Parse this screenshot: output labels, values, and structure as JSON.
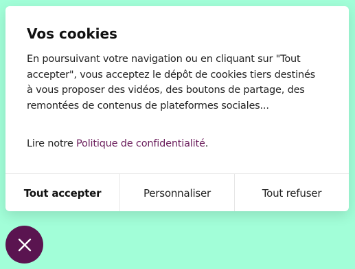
{
  "dialog": {
    "title": "Vos cookies",
    "body": "En poursuivant votre navigation ou en cliquant sur \"Tout accepter\", vous acceptez le dépôt de cookies tiers destinés à vous proposer des vidéos, des boutons de partage, des remontées de contenus de plateformes sociales...",
    "privacy_prefix": "Lire notre ",
    "privacy_link": "Politique de confidentialité",
    "privacy_suffix": "."
  },
  "buttons": {
    "accept_all": "Tout accepter",
    "customize": "Personnaliser",
    "refuse_all": "Tout refuser"
  },
  "fab": {
    "icon": "close-icon"
  },
  "colors": {
    "page_background": "#a2fed8",
    "dialog_background": "#ffffff",
    "link": "#6b1e5c",
    "fab_background": "#5a1450"
  }
}
